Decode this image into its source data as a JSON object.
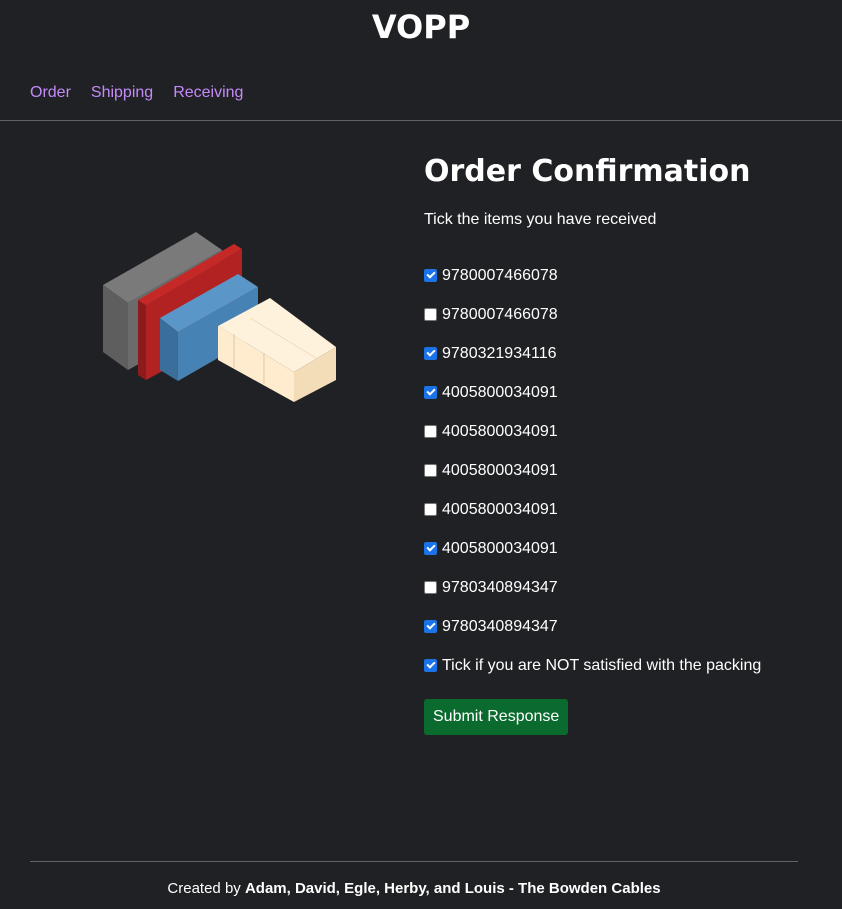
{
  "app": {
    "title": "VOPP"
  },
  "nav": [
    {
      "label": "Order"
    },
    {
      "label": "Shipping"
    },
    {
      "label": "Receiving"
    }
  ],
  "main": {
    "title": "Order Confirmation",
    "instruction": "Tick the items you have received",
    "items": [
      {
        "label": "9780007466078",
        "checked": true
      },
      {
        "label": "9780007466078",
        "checked": false
      },
      {
        "label": "9780321934116",
        "checked": true
      },
      {
        "label": "4005800034091",
        "checked": true
      },
      {
        "label": "4005800034091",
        "checked": false
      },
      {
        "label": "4005800034091",
        "checked": false
      },
      {
        "label": "4005800034091",
        "checked": false
      },
      {
        "label": "4005800034091",
        "checked": true
      },
      {
        "label": "9780340894347",
        "checked": false
      },
      {
        "label": "9780340894347",
        "checked": true
      }
    ],
    "packing": {
      "label": "Tick if you are NOT satisfied with the packing",
      "checked": true
    },
    "submit_label": "Submit Response"
  },
  "footer": {
    "prefix": "Created by ",
    "authors": "Adam, David, Egle, Herby, and Louis - The Bowden Cables"
  },
  "colors": {
    "background": "#202124",
    "nav_link": "#c58af9",
    "checkbox_checked": "#1a73e8",
    "submit_button": "#0b6b2e",
    "box_gray": "#6b6b6b",
    "box_red": "#b22222",
    "box_blue": "#4682b4",
    "box_cream": "#ffebcd"
  }
}
